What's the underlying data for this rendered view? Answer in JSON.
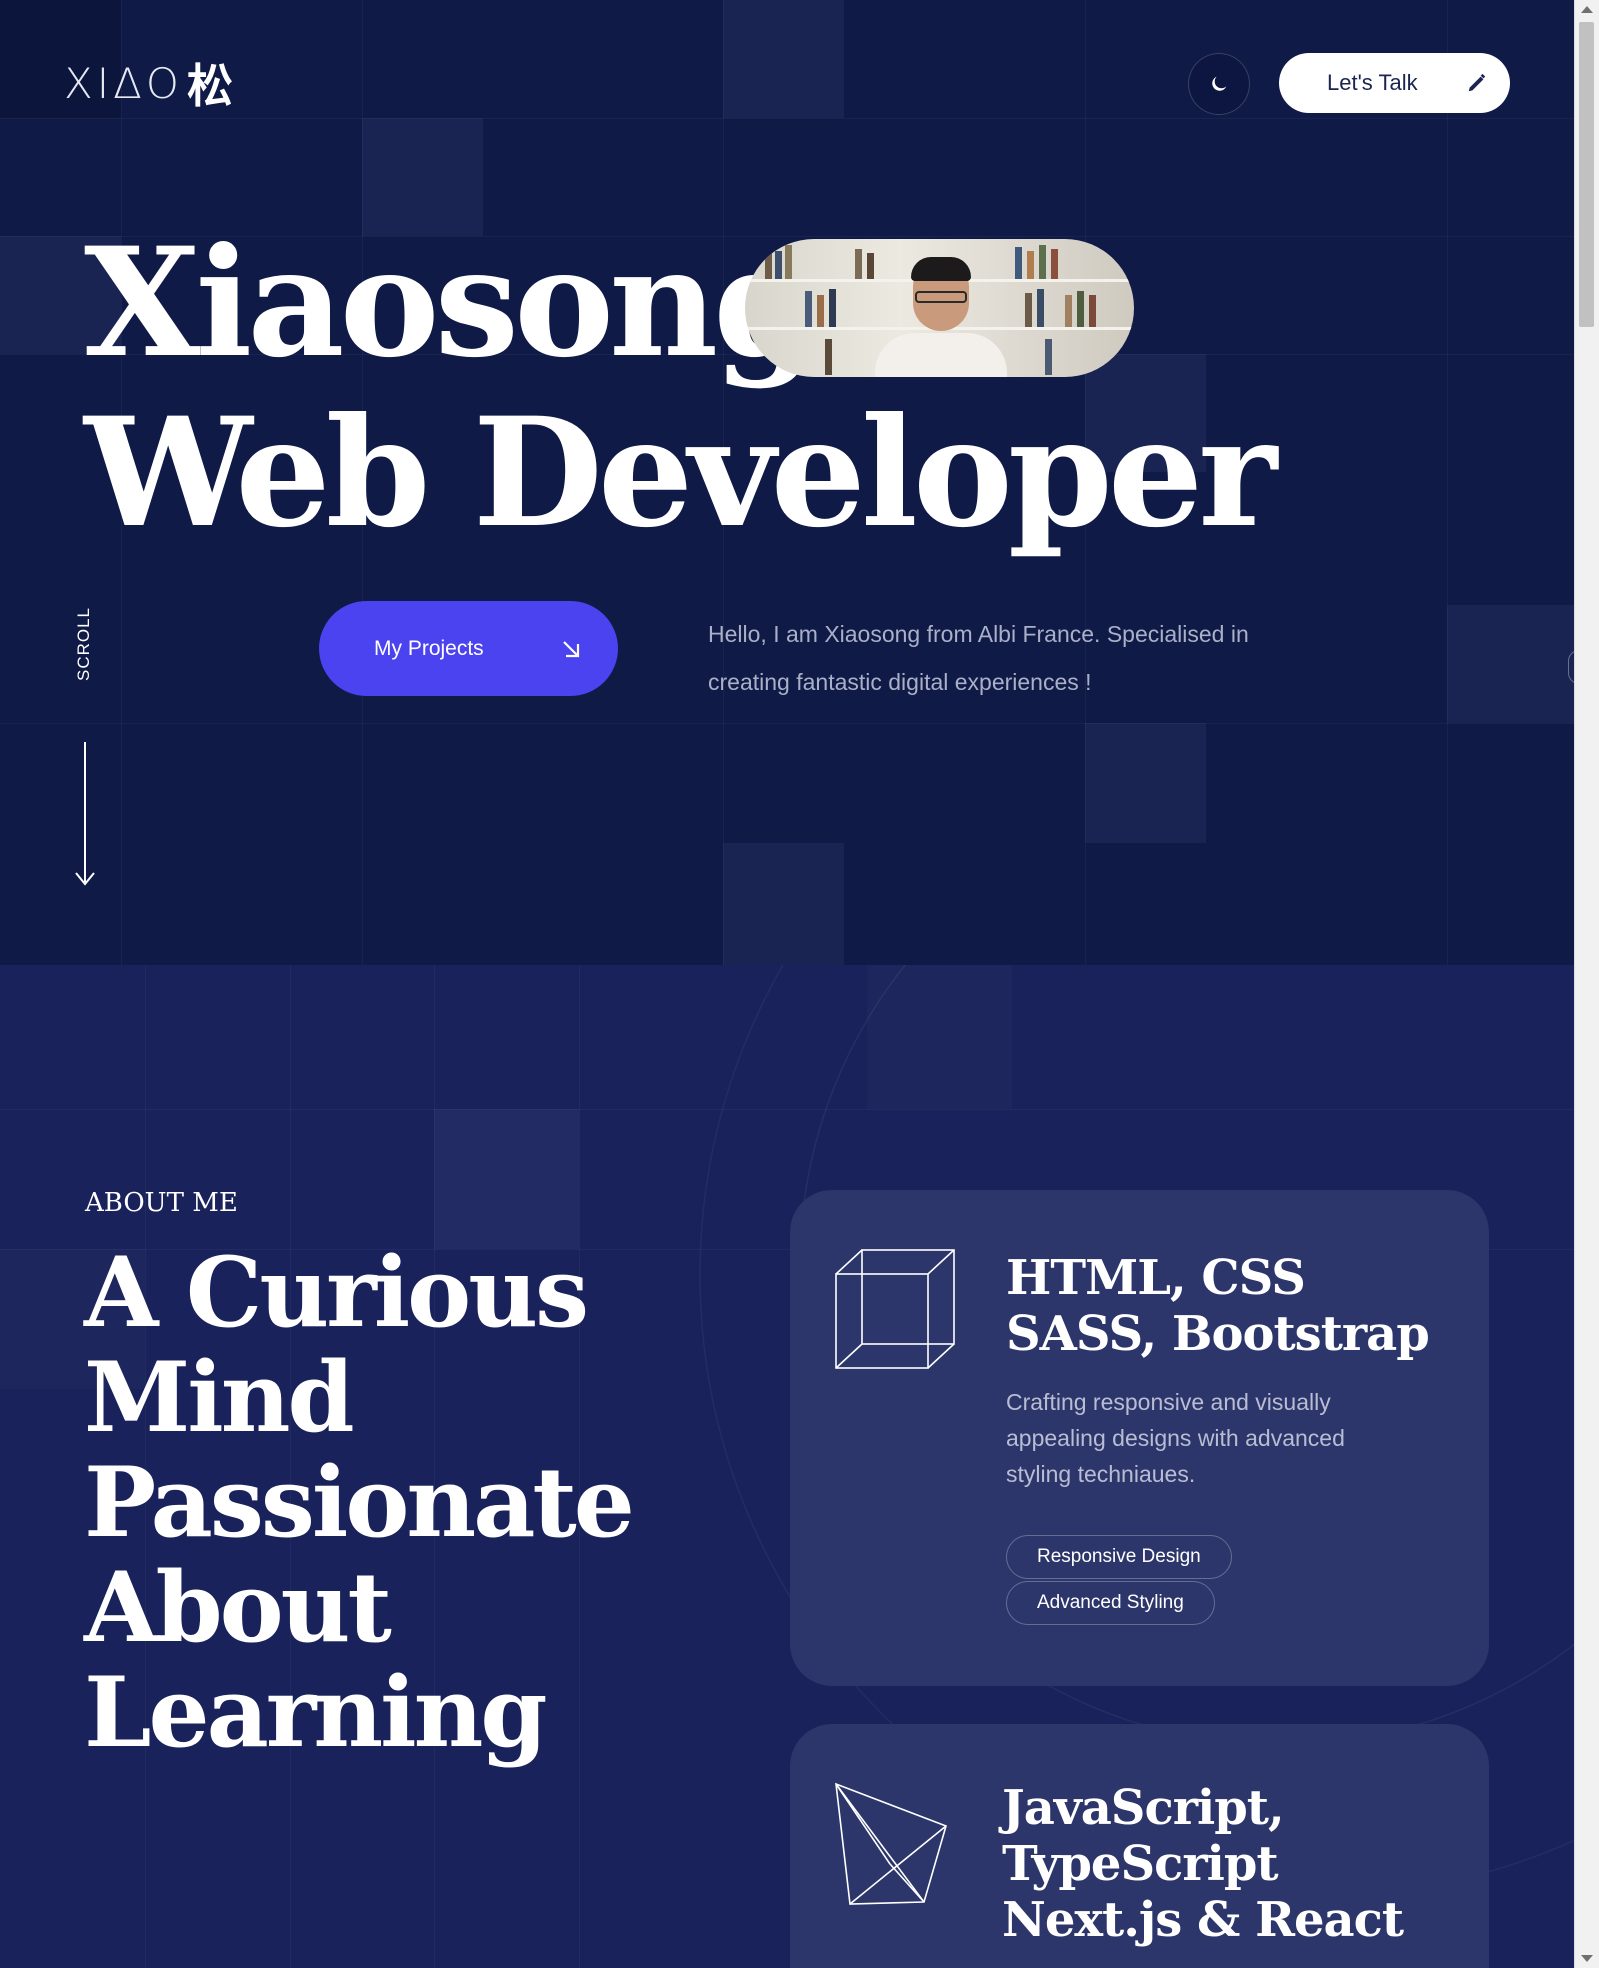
{
  "header": {
    "logo_text": "XIΔO",
    "logo_cjk": "松",
    "cta_label": "Let's Talk",
    "theme_toggle_icon": "moon-icon",
    "cta_icon": "pencil-icon"
  },
  "hero": {
    "title_line1": "Xiaosong",
    "title_line2": "Web Developer",
    "scroll_label": "SCROLL",
    "projects_button_label": "My Projects",
    "projects_button_icon": "arrow-down-right-icon",
    "intro_text": "Hello, I am Xiaosong from Albi France. Specialised in creating fantastic digital experiences !",
    "photo_alt": "portrait"
  },
  "about": {
    "label": "ABOUT ME",
    "title_lines": [
      "A Curious",
      "Mind",
      "Passionate",
      "About",
      "Learning"
    ],
    "cards": [
      {
        "icon": "cube-icon",
        "title_lines": [
          "HTML, CSS",
          "SASS, Bootstrap"
        ],
        "description": "Crafting responsive and visually appealing designs with advanced styling techniaues.",
        "tags": [
          "Responsive Design",
          "Advanced Styling"
        ]
      },
      {
        "icon": "pyramid-icon",
        "title_lines": [
          "JavaScript,",
          "TypeScript",
          "Next.js & React"
        ]
      }
    ]
  },
  "colors": {
    "hero_bg": "#0f1a47",
    "about_bg": "#19225a",
    "card_bg": "#2c366a",
    "accent": "#4b43f0",
    "text_muted": "#aab0c8"
  }
}
